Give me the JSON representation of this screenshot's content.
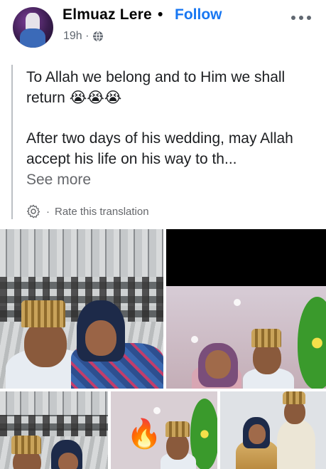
{
  "post": {
    "author": "Elmuaz Lere",
    "separator": "•",
    "follow_label": "Follow",
    "timestamp": "19h ·",
    "audience_icon": "globe-icon",
    "more_icon": "more-options-icon",
    "text_line1": "To Allah we belong and to Him we shall return 😭😭😭",
    "text_line2": "After two days of his wedding, may Allah accept his life on his way to th...",
    "see_more": "See more",
    "translation_icon": "gear-icon",
    "translation_sep": "·",
    "translation_label": "Rate this translation"
  },
  "photos": [
    {
      "name": "photo-couple-curtain"
    },
    {
      "name": "photo-couple-pink-room"
    },
    {
      "name": "photo-couple-curtain-small"
    },
    {
      "name": "photo-fire-emoji-room",
      "overlay_emoji": "🔥"
    },
    {
      "name": "photo-couple-standing"
    }
  ],
  "colors": {
    "follow": "#1877f2",
    "meta": "#65676b",
    "quote_bar": "#bcc0c4"
  }
}
